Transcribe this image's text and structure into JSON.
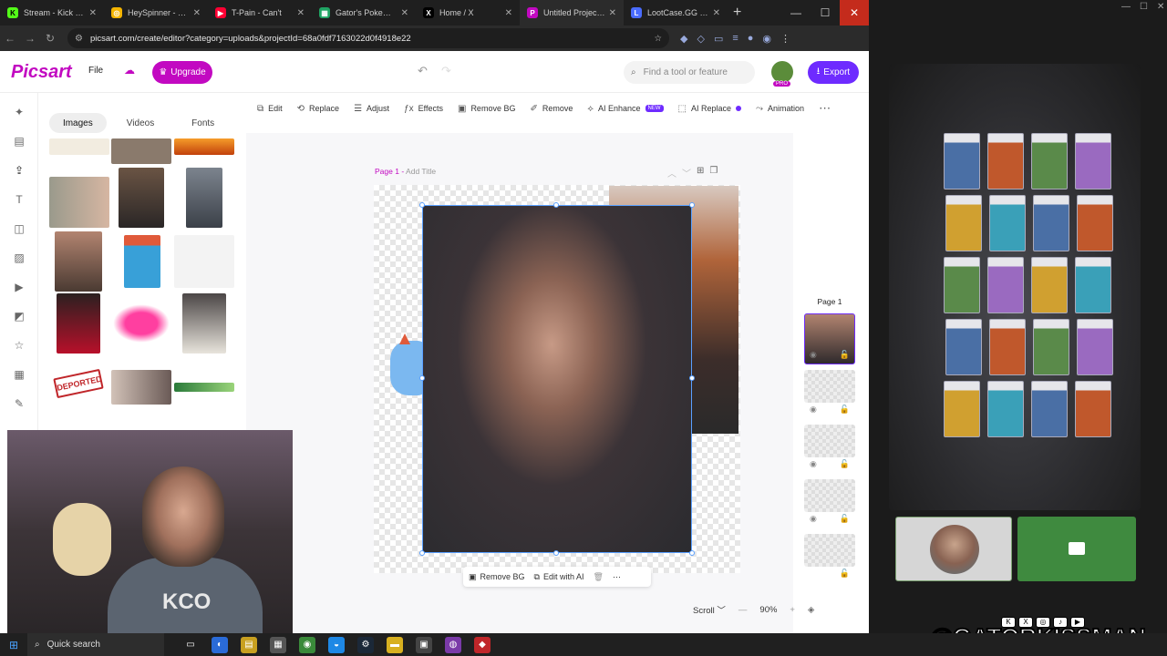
{
  "browser": {
    "tabs": [
      {
        "label": "Stream - Kick Dash",
        "icon": "kick-icon",
        "color": "#53fc18"
      },
      {
        "label": "HeySpinner - Spin",
        "icon": "spinner-icon",
        "color": "#f4b400"
      },
      {
        "label": "T-Pain - Can't",
        "icon": "youtube-icon",
        "color": "#ff0033"
      },
      {
        "label": "Gator's Pokemon",
        "icon": "sheets-icon",
        "color": "#1fa463"
      },
      {
        "label": "Home / X",
        "icon": "x-icon",
        "color": "#000000"
      },
      {
        "label": "Untitled Project | P",
        "icon": "picsart-icon",
        "color": "#c209c1"
      },
      {
        "label": "LootCase.GG - Ca",
        "icon": "lootcase-icon",
        "color": "#4a6cff"
      }
    ],
    "url": "picsart.com/create/editor?category=uploads&projectId=68a0fdf7163022d0f4918e22"
  },
  "app": {
    "logo": "Picsart",
    "file_label": "File",
    "upgrade_label": "Upgrade",
    "search_placeholder": "Find a tool or feature",
    "pro_badge": "PRO",
    "export_label": "Export",
    "panel_tabs": [
      "Images",
      "Videos",
      "Fonts"
    ],
    "deported_sticker": "DEPORTED",
    "toolbar": [
      {
        "label": "Edit",
        "icon": "edit-icon"
      },
      {
        "label": "Replace",
        "icon": "replace-icon"
      },
      {
        "label": "Adjust",
        "icon": "adjust-icon"
      },
      {
        "label": "Effects",
        "icon": "effects-icon"
      },
      {
        "label": "Remove BG",
        "icon": "remove-bg-icon"
      },
      {
        "label": "Remove",
        "icon": "eraser-icon"
      },
      {
        "label": "AI Enhance",
        "icon": "ai-enhance-icon",
        "badge": "NEW"
      },
      {
        "label": "AI Replace",
        "icon": "ai-replace-icon"
      },
      {
        "label": "Animation",
        "icon": "animation-icon"
      }
    ],
    "page_label": "Page 1",
    "add_title": "Add Title",
    "bottom_actions": [
      "Remove BG",
      "Edit with AI"
    ],
    "pages_title": "Page 1",
    "scroll_label": "Scroll",
    "zoom": "90%"
  },
  "stream": {
    "handle": "@GATORKISSMAN",
    "webcam_logo": "KCO"
  },
  "taskbar": {
    "search_label": "Quick search"
  }
}
